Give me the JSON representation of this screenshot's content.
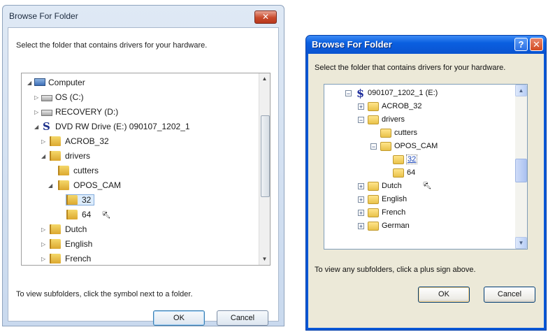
{
  "left_dialog": {
    "title": "Browse For Folder",
    "close_symbol": "✕",
    "prompt": "Select the folder that contains drivers for your hardware.",
    "tree": [
      {
        "label": "Computer",
        "expander": "◢",
        "icon": "computer-icon"
      },
      {
        "label": "OS (C:)",
        "expander": "▷",
        "icon": "hard-drive-icon"
      },
      {
        "label": "RECOVERY (D:)",
        "expander": "▷",
        "icon": "hard-drive-icon"
      },
      {
        "label": "DVD RW Drive (E:) 090107_1202_1",
        "expander": "◢",
        "icon": "dvd-drive-icon",
        "icon_glyph": "S"
      },
      {
        "label": "ACROB_32",
        "expander": "▷",
        "icon": "folder-icon"
      },
      {
        "label": "drivers",
        "expander": "◢",
        "icon": "folder-icon"
      },
      {
        "label": "cutters",
        "expander": "",
        "icon": "folder-icon"
      },
      {
        "label": "OPOS_CAM",
        "expander": "◢",
        "icon": "folder-icon"
      },
      {
        "label": "32",
        "expander": "",
        "icon": "folder-icon",
        "selected": true
      },
      {
        "label": "64",
        "expander": "",
        "icon": "folder-icon"
      },
      {
        "label": "Dutch",
        "expander": "▷",
        "icon": "folder-icon"
      },
      {
        "label": "English",
        "expander": "▷",
        "icon": "folder-icon"
      },
      {
        "label": "French",
        "expander": "▷",
        "icon": "folder-icon"
      }
    ],
    "note": "To view subfolders, click the symbol next to a folder.",
    "ok_label": "OK",
    "cancel_label": "Cancel"
  },
  "right_dialog": {
    "title": "Browse For Folder",
    "help_symbol": "?",
    "close_symbol": "✕",
    "prompt": "Select the folder that contains drivers for your hardware.",
    "tree": [
      {
        "label": "090107_1202_1 (E:)",
        "expander": "−",
        "icon": "dvd-drive-icon",
        "icon_glyph": "$"
      },
      {
        "label": "ACROB_32",
        "expander": "+",
        "icon": "folder-icon"
      },
      {
        "label": "drivers",
        "expander": "−",
        "icon": "folder-icon"
      },
      {
        "label": "cutters",
        "expander": "",
        "icon": "folder-icon"
      },
      {
        "label": "OPOS_CAM",
        "expander": "−",
        "icon": "folder-icon"
      },
      {
        "label": "32",
        "expander": "",
        "icon": "folder-icon",
        "selected": true
      },
      {
        "label": "64",
        "expander": "",
        "icon": "folder-icon"
      },
      {
        "label": "Dutch",
        "expander": "+",
        "icon": "folder-icon"
      },
      {
        "label": "English",
        "expander": "+",
        "icon": "folder-icon"
      },
      {
        "label": "French",
        "expander": "+",
        "icon": "folder-icon"
      },
      {
        "label": "German",
        "expander": "+",
        "icon": "folder-icon"
      }
    ],
    "note": "To view any subfolders, click a plus sign above.",
    "ok_label": "OK",
    "cancel_label": "Cancel"
  },
  "scroll_arrows": {
    "up": "▲",
    "down": "▼"
  },
  "cursor_glyph": "↖"
}
